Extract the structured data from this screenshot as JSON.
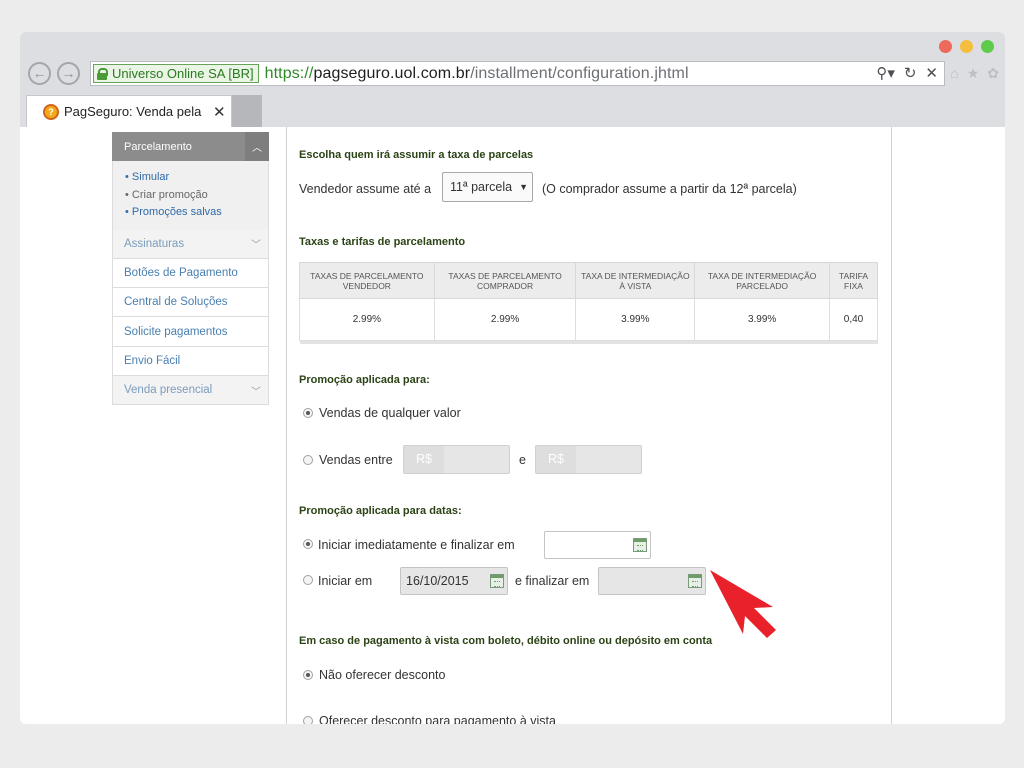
{
  "browser": {
    "cert_label": "Universo Online SA [BR]",
    "url_scheme": "https://",
    "url_host": "pagseguro.uol.com.br",
    "url_path": "/installment/configuration.jhtml",
    "tab_title": "PagSeguro: Venda pela in",
    "addr_icons": [
      "search-icon",
      "refresh-icon",
      "close-icon"
    ],
    "toolbar_icons": [
      "home-icon",
      "star-icon",
      "gear-icon"
    ]
  },
  "sidebar": {
    "active": "Parcelamento",
    "sub_items": [
      {
        "label": "Simular",
        "style": "link"
      },
      {
        "label": "Criar promoção",
        "style": "dim"
      },
      {
        "label": "Promoções salvas",
        "style": "link"
      }
    ],
    "items": [
      "Assinaturas",
      "Botões de Pagamento",
      "Central de Soluções",
      "Solicite pagamentos",
      "Envio Fácil",
      "Venda presencial"
    ]
  },
  "main": {
    "heading1": "Escolha quem irá assumir a taxa de parcelas",
    "vendor_label": "Vendedor assume até a",
    "installment_select": "11ª parcela",
    "buyer_note": "(O comprador assume a partir da 12ª parcela)",
    "heading2": "Taxas e tarifas de parcelamento",
    "table": {
      "headers": [
        "Taxas de parcelamento vendedor",
        "Taxas de parcelamento comprador",
        "Taxa de intermediação à vista",
        "Taxa de intermediação parcelado",
        "Tarifa fixa"
      ],
      "row": [
        "2.99%",
        "2.99%",
        "3.99%",
        "3.99%",
        "0,40"
      ]
    },
    "heading3": "Promoção aplicada para:",
    "opt_any_value": "Vendas de qualquer valor",
    "opt_between": "Vendas entre",
    "currency_prefix": "R$",
    "and_label": "e",
    "heading4": "Promoção aplicada para datas:",
    "opt_immediate": "Iniciar imediatamente e finalizar em",
    "opt_start_at": "Iniciar em",
    "start_date": "16/10/2015",
    "end_label": "e finalizar em",
    "heading5": "Em caso de pagamento à vista com boleto, débito online ou depósito em conta",
    "opt_no_discount": "Não oferecer desconto",
    "opt_discount": "Oferecer desconto para pagamento à vista"
  },
  "colors": {
    "arrow": "#e8212b",
    "heading": "#2b4315",
    "link": "#2f6aa7"
  }
}
